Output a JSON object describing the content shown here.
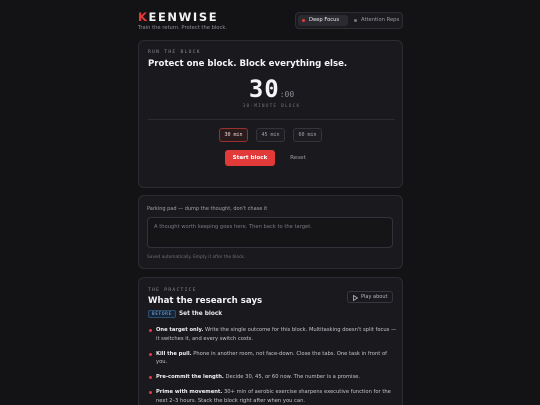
{
  "header": {
    "brand_first": "K",
    "brand_rest": "EENWISE",
    "tagline": "Train the return. Protect the block.",
    "modes": [
      {
        "label": "Deep Focus",
        "active": true
      },
      {
        "label": "Attention Reps",
        "active": false
      }
    ]
  },
  "block": {
    "eyebrow": "RUN THE BLOCK",
    "title": "Protect one block. Block everything else.",
    "timer_minutes": "30",
    "timer_seconds": ":00",
    "timer_label": "30-MINUTE BLOCK",
    "durations": [
      {
        "label": "30 min",
        "active": true
      },
      {
        "label": "45 min",
        "active": false
      },
      {
        "label": "60 min",
        "active": false
      }
    ],
    "start_label": "Start block",
    "reset_label": "Reset"
  },
  "parking": {
    "label": "Parking pad — dump the thought, don't chase it",
    "placeholder": "A thought worth keeping goes here. Then back to the target.",
    "note": "Saved automatically. Empty it after the block."
  },
  "practice": {
    "eyebrow": "THE PRACTICE",
    "title": "What the research says",
    "play_label": "Play about",
    "badge": "BEFORE",
    "section_title": "Set the block",
    "points": [
      {
        "bold": "One target only.",
        "text": " Write the single outcome for this block. Multitasking doesn't split focus — it switches it, and every switch costs."
      },
      {
        "bold": "Kill the pull.",
        "text": " Phone in another room, not face-down. Close the tabs. One task in front of you."
      },
      {
        "bold": "Pre-commit the length.",
        "text": " Decide 30, 45, or 60 now. The number is a promise."
      },
      {
        "bold": "Prime with movement.",
        "text": " 30+ min of aerobic exercise sharpens executive function for the next 2–3 hours. Stack the block right after when you can."
      }
    ]
  },
  "colors": {
    "accent": "#e8393a",
    "background": "#131316",
    "card": "#1a1a1e"
  }
}
